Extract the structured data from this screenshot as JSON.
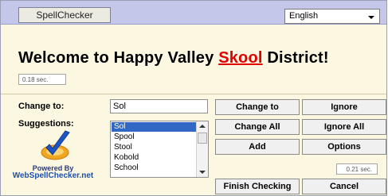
{
  "topbar": {
    "tab_label": "SpellChecker",
    "language": "English"
  },
  "sentence": {
    "before": "Welcome to Happy Valley ",
    "error_word": "Skool",
    "after": " District!"
  },
  "timers": {
    "top": "0.18 sec.",
    "bottom": "0.21 sec."
  },
  "labels": {
    "change_to": "Change to:",
    "suggestions": "Suggestions:"
  },
  "change_to_value": "Sol",
  "suggestions": [
    "Sol",
    "Spool",
    "Stool",
    "Kobold",
    "School"
  ],
  "selected_suggestion": "Sol",
  "buttons": {
    "change_to": "Change to",
    "ignore": "Ignore",
    "change_all": "Change All",
    "ignore_all": "Ignore All",
    "add": "Add",
    "options": "Options",
    "finish": "Finish Checking",
    "cancel": "Cancel"
  },
  "branding": {
    "powered_by": "Powered By",
    "site": "WebSpellChecker.net"
  },
  "colors": {
    "topbar": "#c4c6ea",
    "panel": "#fbf7e1",
    "error_word": "#e00000",
    "selection": "#3168c6"
  }
}
